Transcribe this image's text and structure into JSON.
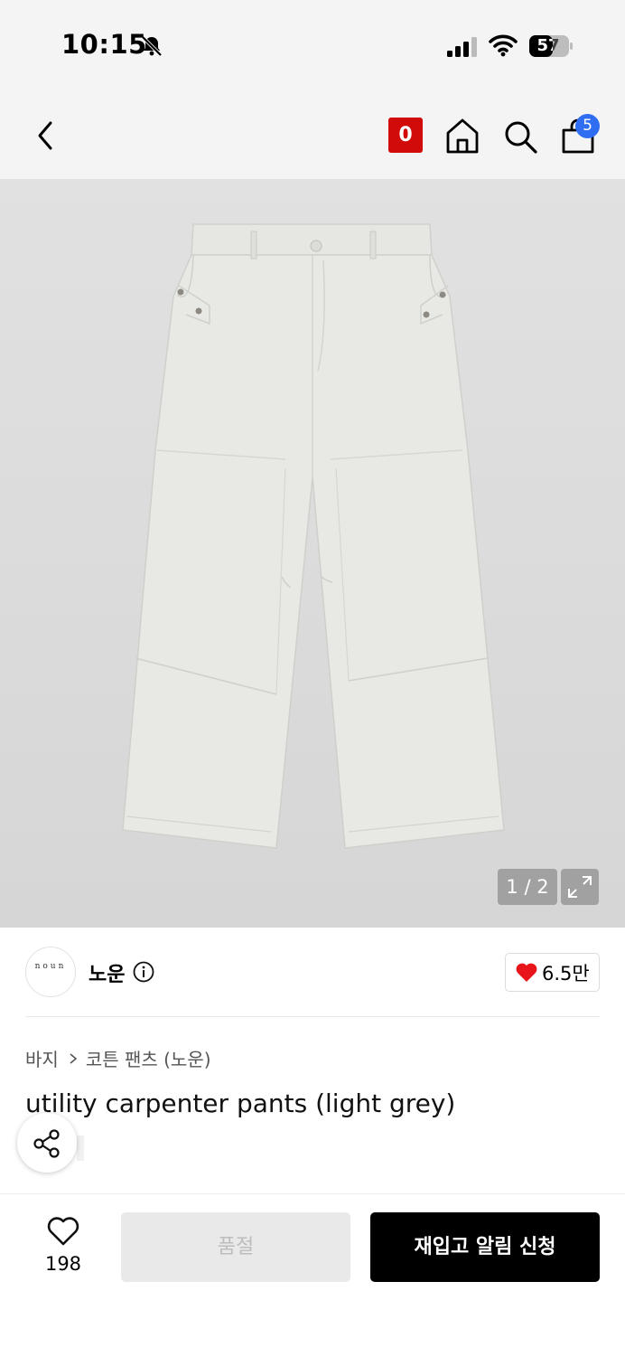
{
  "status_bar": {
    "time": "10:15",
    "battery": "57",
    "icons": [
      "bell-slash-icon",
      "signal-icon",
      "wifi-icon",
      "battery-icon"
    ]
  },
  "nav": {
    "badge": "0",
    "cart_count": "5",
    "icons": [
      "back-icon",
      "home-icon",
      "search-icon",
      "shopping-bag-icon"
    ]
  },
  "gallery": {
    "counter": "1 / 2"
  },
  "brand": {
    "logo_text": "noun",
    "name": "노운",
    "likes": "6.5만"
  },
  "breadcrumb": {
    "category": "바지",
    "subcategory": "코튼 팬츠 (노운)"
  },
  "product": {
    "title": "utility carpenter pants (light grey)"
  },
  "bottom_bar": {
    "wish_count": "198",
    "soldout_label": "품절",
    "restock_label": "재입고 알림 신청"
  },
  "colors": {
    "accent_red": "#d10a0a",
    "cart_badge_blue": "#2f6df2",
    "heart_red": "#e8151b",
    "primary_button": "#000000",
    "disabled_button": "#e9e9e9"
  }
}
